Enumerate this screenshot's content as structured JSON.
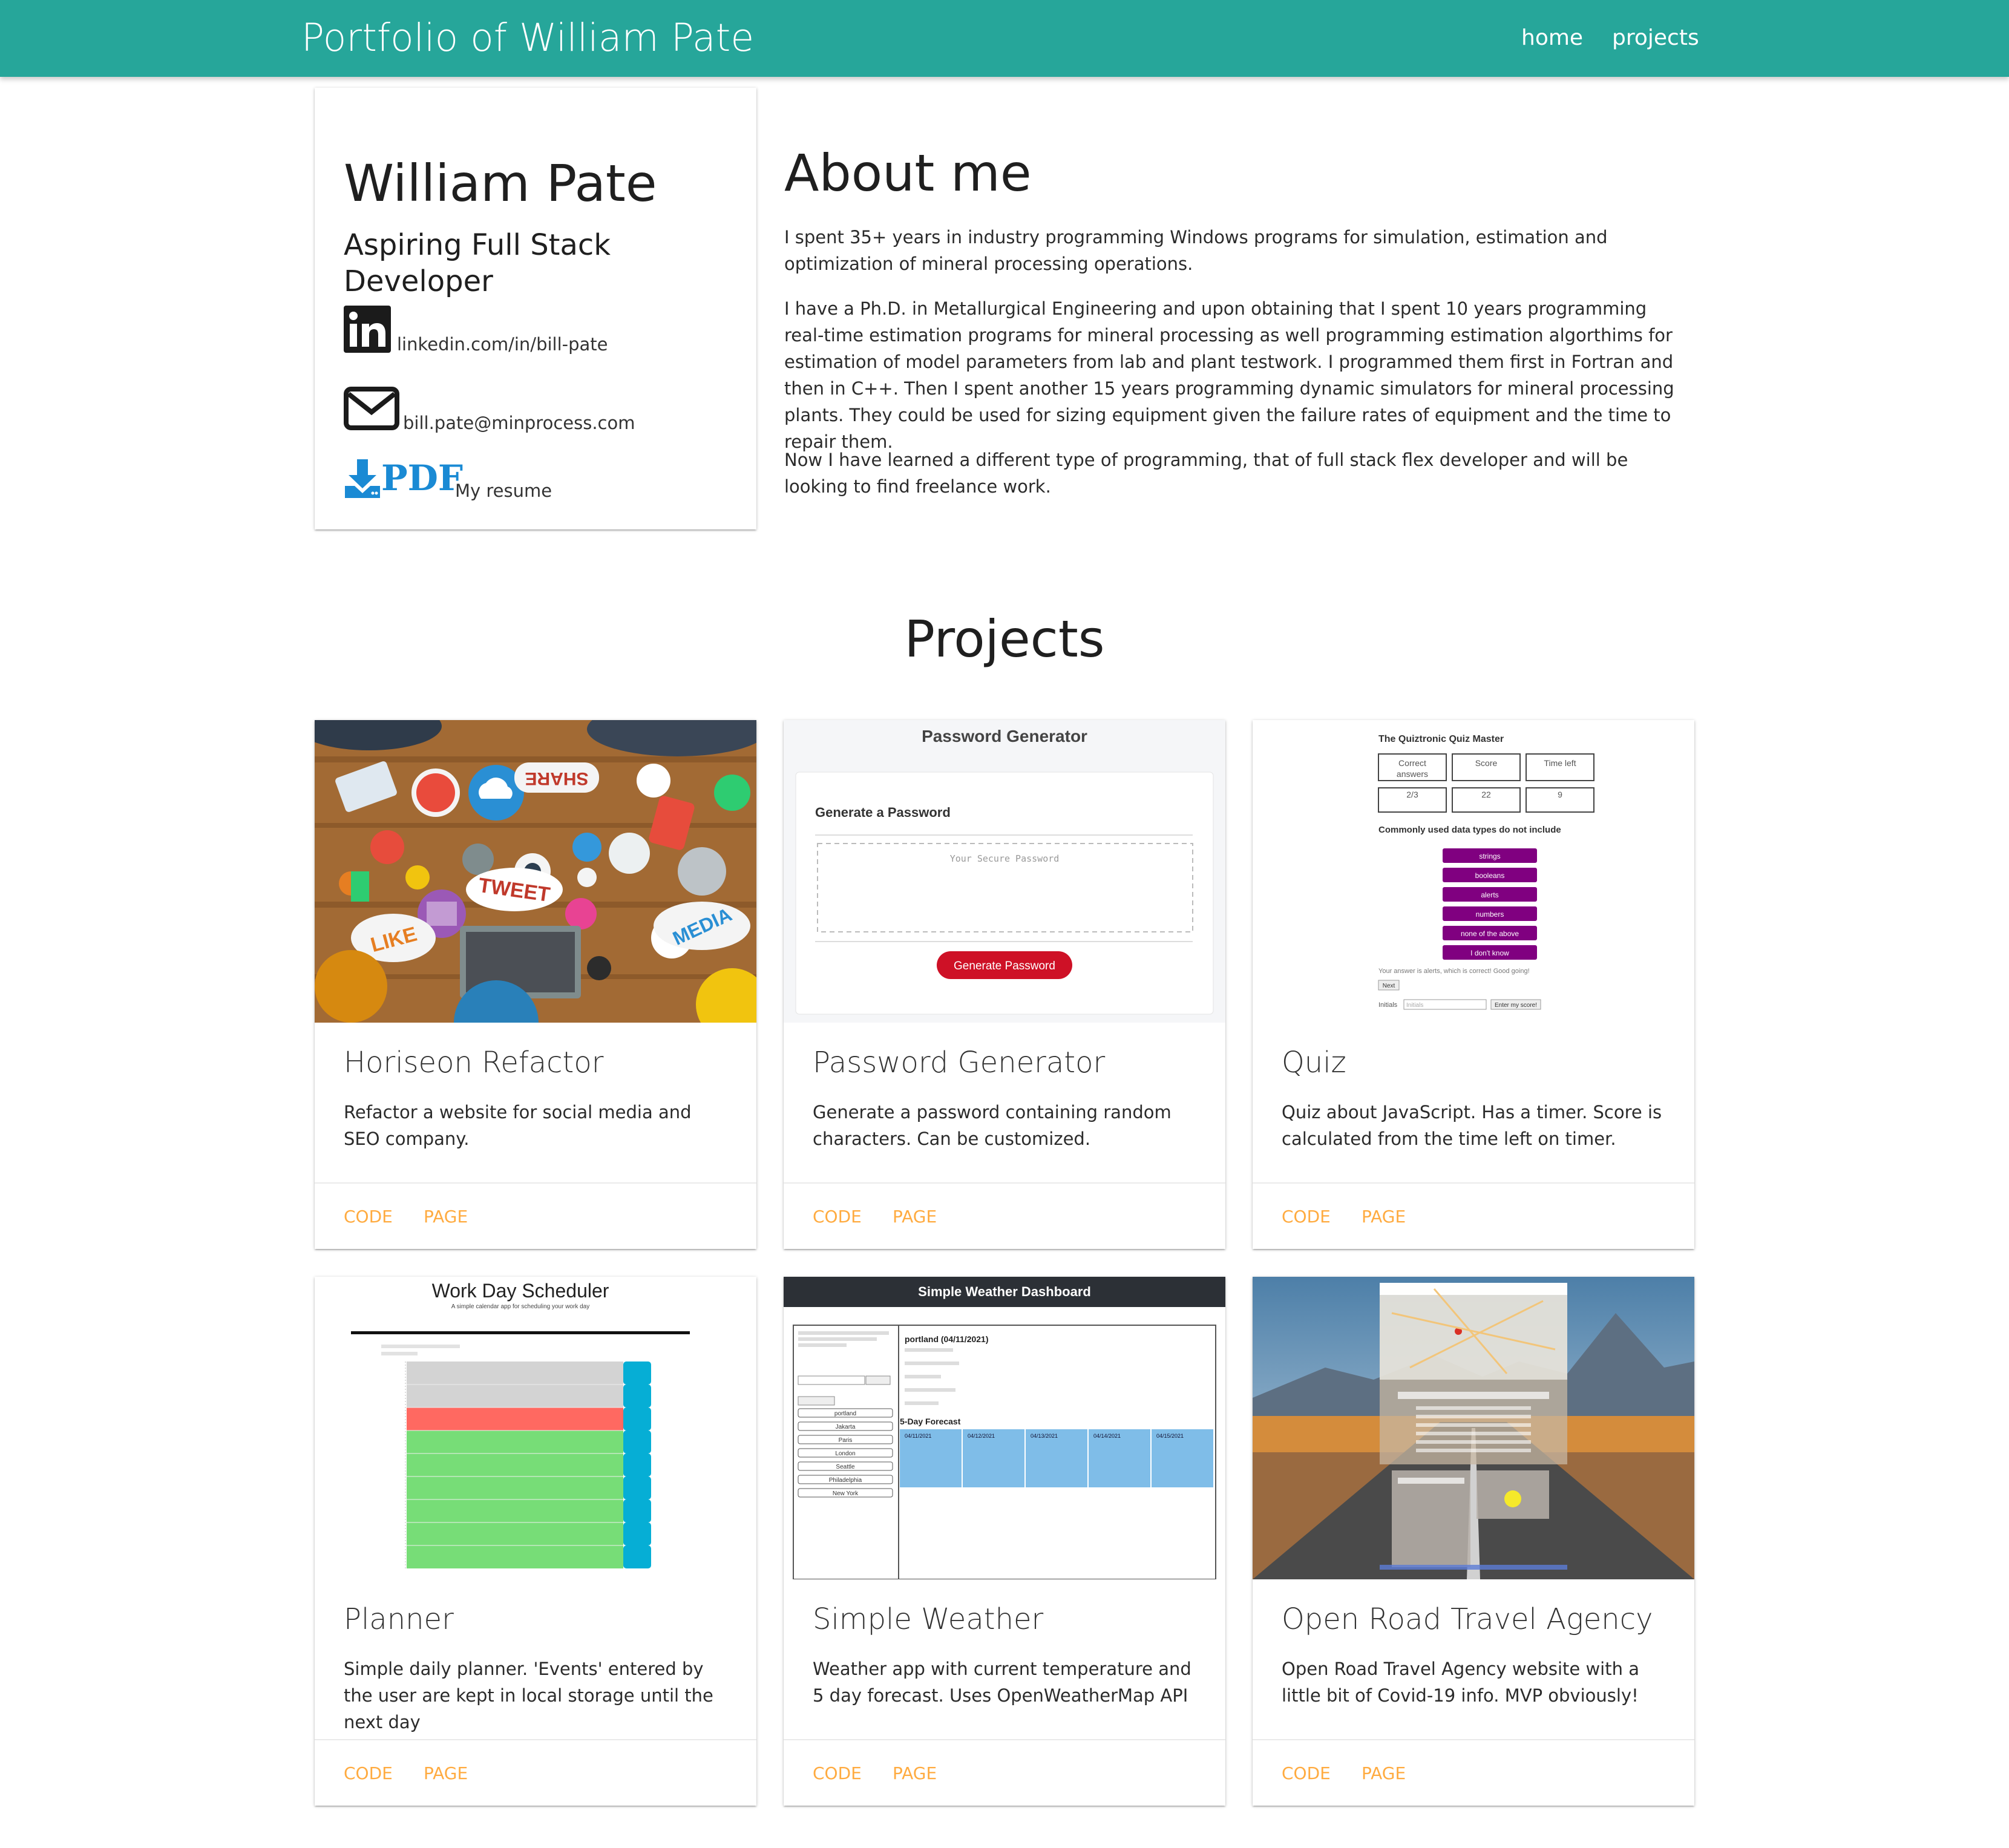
{
  "nav": {
    "brand": "Portfolio of William Pate",
    "links": [
      "home",
      "projects"
    ]
  },
  "profile": {
    "name": "William Pate",
    "role": "Aspiring Full Stack Developer",
    "linkedin": "linkedin.com/in/bill-pate",
    "email": "bill.pate@minprocess.com",
    "resume_icon_text": "PDF",
    "resume": "My resume"
  },
  "about": {
    "title": "About me",
    "paragraphs": [
      "I spent 35+ years in industry programming Windows programs for simulation, estimation and optimization of mineral processing operations.",
      "I have a Ph.D. in Metallurgical Engineering and upon obtaining that I spent 10 years programming real-time estimation programs for mineral processing as well programming estimation algorthims for estimation of model parameters from lab and plant testwork. I programmed them first in Fortran and then in C++. Then I spent another 15 years programming dynamic simulators for mineral processing plants. They could be used for sizing equipment given the failure rates of equipment and the time to repair them.",
      "Now I have learned a different type of programming, that of full stack flex developer and will be looking to find freelance work."
    ]
  },
  "projects": {
    "title": "Projects",
    "items": [
      {
        "title": "Horiseon Refactor",
        "description": "Refactor a website for social media and SEO company.",
        "code": "CODE",
        "page": "PAGE",
        "thumb": {
          "words": [
            "SHARE",
            "TWEET",
            "LIKE",
            "MEDIA"
          ]
        }
      },
      {
        "title": "Password Generator",
        "description": "Generate a password containing random characters. Can be customized.",
        "code": "CODE",
        "page": "PAGE",
        "thumb": {
          "header": "Password Generator",
          "card_title": "Generate a Password",
          "placeholder": "Your Secure Password",
          "button": "Generate Password"
        }
      },
      {
        "title": "Quiz",
        "description": "Quiz about JavaScript. Has a timer. Score is calculated from the time left on timer.",
        "code": "CODE",
        "page": "PAGE",
        "thumb": {
          "header": "The Quiztronic Quiz Master",
          "labels": [
            "Correct answers",
            "Score",
            "Time left"
          ],
          "values": [
            "2/3",
            "22",
            "9"
          ],
          "question": "Commonly used data types do not include",
          "answers": [
            "strings",
            "booleans",
            "alerts",
            "numbers",
            "none of the above",
            "I don't know"
          ],
          "feedback": "Your answer is alerts, which is correct! Good going!",
          "next": "Next",
          "initials_label": "Initials",
          "initials_placeholder": "Initials",
          "submit": "Enter my score!"
        }
      },
      {
        "title": "Planner",
        "description": "Simple daily planner. 'Events' entered by the user are kept in local storage until the next day",
        "code": "CODE",
        "page": "PAGE",
        "thumb": {
          "header": "Work Day Scheduler",
          "subheader": "A simple calendar app for scheduling your work day"
        }
      },
      {
        "title": "Simple Weather",
        "description": "Weather app with current temperature and 5 day forecast. Uses OpenWeatherMap API",
        "code": "CODE",
        "page": "PAGE",
        "thumb": {
          "header": "Simple Weather Dashboard",
          "city": "portland (04/11/2021)",
          "forecast": "5-Day Forecast",
          "cities": [
            "portland",
            "Jakarta",
            "Paris",
            "London",
            "Seattle",
            "Philadelphia",
            "New York"
          ],
          "dates": [
            "04/11/2021",
            "04/12/2021",
            "04/13/2021",
            "04/14/2021",
            "04/15/2021"
          ]
        }
      },
      {
        "title": "Open Road Travel Agency",
        "description": "Open Road Travel Agency website with a little bit of Covid-19 info. MVP obviously!",
        "code": "CODE",
        "page": "PAGE",
        "thumb": {}
      }
    ]
  },
  "colors": {
    "nav": "#26a69a",
    "link": "#ffab40",
    "pdf": "#1a8ad4"
  }
}
